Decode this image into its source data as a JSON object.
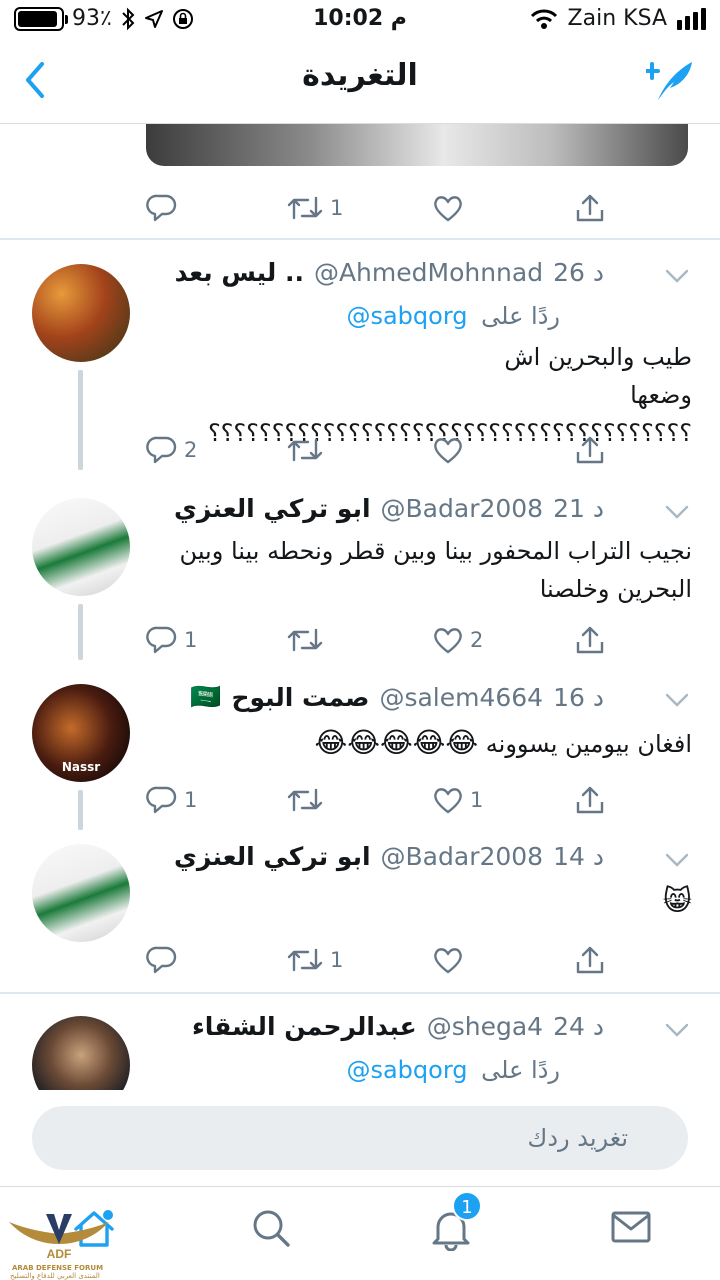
{
  "status_bar": {
    "battery": "93٪",
    "battery_level": 0.93,
    "time": "10:02 م",
    "carrier": "Zain KSA"
  },
  "header": {
    "title": "التغريدة"
  },
  "top_tweet": {
    "retweets": "1"
  },
  "tweets": [
    {
      "name": "ليس بعد ..",
      "handle": "@AhmedMohnnad",
      "time": "26 د",
      "reply_label": "ردًا على",
      "reply_to": "@sabqorg",
      "text_line1": "طيب والبحرين اش",
      "text_line2": "وضعها ؟؟؟؟؟؟؟؟؟؟؟؟؟؟؟؟؟؟؟؟؟؟؟؟؟؟؟؟؟؟؟؟؟؟؟؟؟؟",
      "replies": "2",
      "retweets": "",
      "likes": ""
    },
    {
      "name": "ابو تركي العنزي",
      "handle": "@Badar2008",
      "time": "21 د",
      "text_line1": "نجيب التراب المحفور بينا وبين قطر ونحطه بينا وبين",
      "text_line2": "البحرين وخلصنا",
      "replies": "1",
      "retweets": "",
      "likes": "2"
    },
    {
      "name": "صمت البوح",
      "flag": "🇸🇦",
      "handle": "@salem4664",
      "time": "16 د",
      "text": "افغان بيومين يسوونه",
      "emojis": "😂😂😂😂😂",
      "replies": "1",
      "retweets": "",
      "likes": "1",
      "avatar_text": "Nassr"
    },
    {
      "name": "ابو تركي العنزي",
      "handle": "@Badar2008",
      "time": "14 د",
      "emoji": "😸",
      "replies": "",
      "retweets": "1",
      "likes": ""
    },
    {
      "name": "عبدالرحمن الشقاء",
      "handle": "@shega4",
      "time": "24 د",
      "reply_label": "ردًا على",
      "reply_to": "@sabqorg"
    }
  ],
  "reply_input": {
    "placeholder": "تغريد ردك"
  },
  "tabbar": {
    "notifications_badge": "1"
  },
  "watermark": {
    "line1": "ARAB DEFENSE FORUM",
    "line2": "المنتدى العربي للدفاع والتسليح"
  },
  "colors": {
    "accent": "#1da1f2",
    "text": "#14171a",
    "muted": "#657786"
  }
}
